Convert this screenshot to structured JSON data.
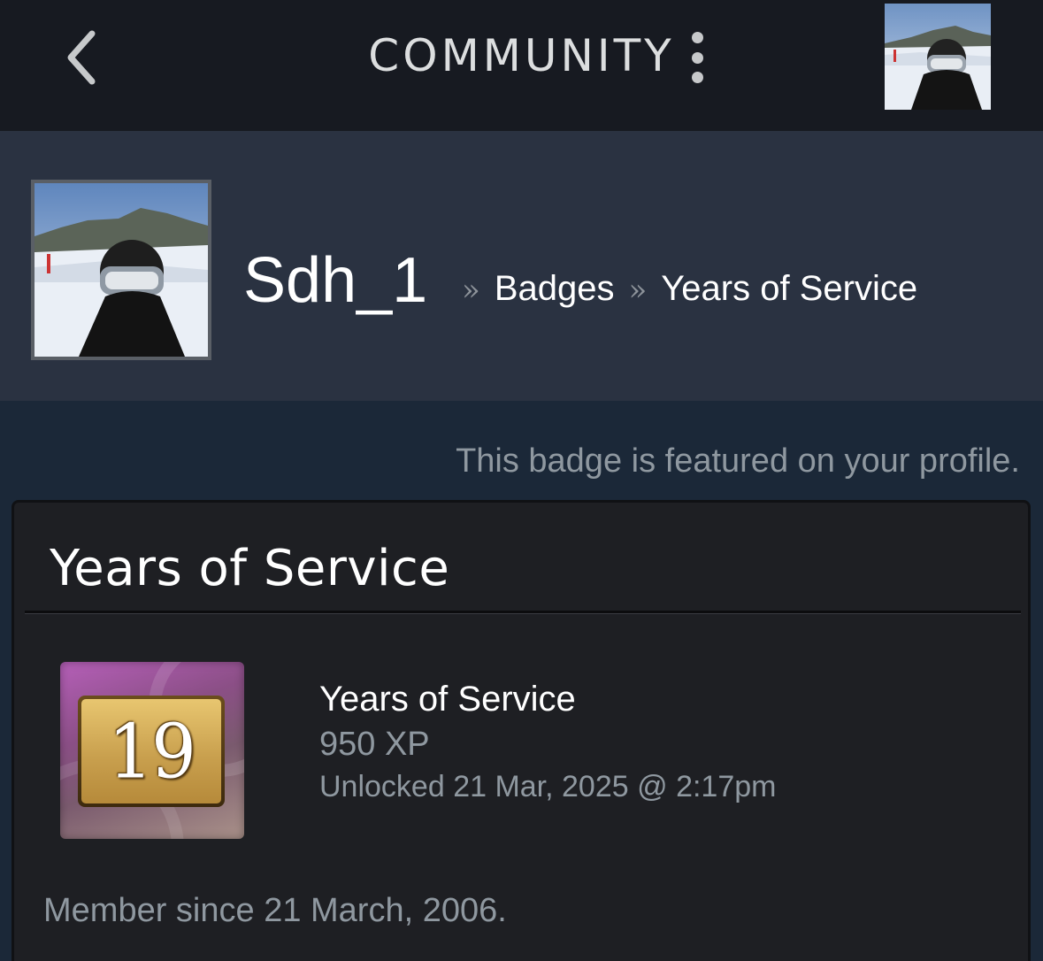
{
  "topbar": {
    "title": "COMMUNITY",
    "back_icon": "chevron-left-icon",
    "menu_icon": "more-vertical-icon"
  },
  "profile": {
    "username": "Sdh_1",
    "breadcrumb": {
      "separator": "»",
      "items": [
        "Badges",
        "Years of Service"
      ]
    }
  },
  "featured_note": "This badge is featured on your profile.",
  "badge_panel": {
    "title": "Years of Service",
    "badge": {
      "number": "19",
      "name": "Years of Service",
      "xp": "950 XP",
      "unlocked": "Unlocked 21 Mar, 2025 @ 2:17pm"
    },
    "member_since": "Member since 21 March, 2006."
  },
  "colors": {
    "topbar_bg": "#171a21",
    "header_bg": "#2a3241",
    "page_bg": "#1b2838",
    "panel_bg": "#1e1f23",
    "muted_text": "#8f98a0"
  }
}
